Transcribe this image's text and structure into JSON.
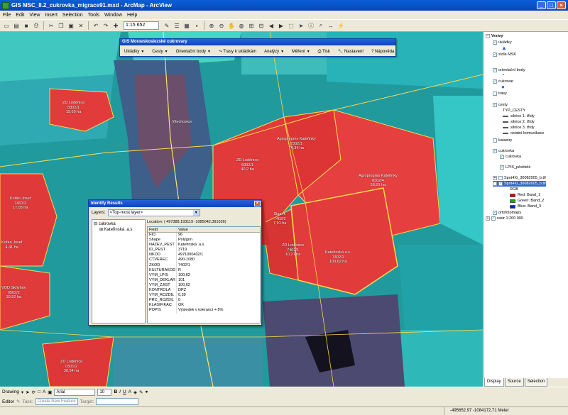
{
  "window": {
    "title": "GIS MSC_8.2_cukrovka_migrace91.mxd - ArcMap - ArcView"
  },
  "menu": [
    "File",
    "Edit",
    "View",
    "Insert",
    "Selection",
    "Tools",
    "Window",
    "Help"
  ],
  "toolbar": {
    "scale": "1:15 652"
  },
  "gis_toolbar": {
    "title": "GIS Moravskoslezské cukrovary",
    "buttons": [
      "Ukládky",
      "Cesty",
      "Orientační body",
      "Trasy k ukládkám",
      "Analýzy",
      "Měření",
      "Tisk",
      "Nastavení",
      "Nápověda"
    ]
  },
  "map": {
    "labels": [
      {
        "text": "ZD Loděnice\n8302/1\n19,69 ha"
      },
      {
        "text": "Všechovice"
      },
      {
        "text": "ZD Loděnice\n8302/1\n40,2 ha"
      },
      {
        "text": "Agroprogres Kateřinky\n7302/1\n74,34 ha"
      },
      {
        "text": "Agroprogres Kateřinky\n8302/4\n58,29 ha"
      },
      {
        "text": "Kateřinská a.s.\n7402/1\n100,62 ha"
      },
      {
        "text": "ZD Loděnice\n7402/1\n10,21 ha"
      },
      {
        "text": "Sigar f.\n7402/2\n7,91 ha"
      },
      {
        "text": "Kořán Josef\n7401/2\n17,05 ha"
      },
      {
        "text": "VOD Skřivňov\n0502/2\n30,52 ha"
      },
      {
        "text": "ZD Loděnice\n0501/2\n30,94 ha"
      },
      {
        "text": "Kořán Josef\n4,41 ha"
      }
    ]
  },
  "identify": {
    "title": "Identify Results",
    "layers_label": "Layers:",
    "layers_value": "<Top-most layer>",
    "tree": [
      "cukrovka",
      "Kateřinská .a.s"
    ],
    "location": "Location: ( 497388,193119 -1085042,391026)",
    "headers": [
      "Field",
      "Value"
    ],
    "rows": [
      [
        "FID",
        "96"
      ],
      [
        "Shape",
        "Polygon"
      ],
      [
        "NAZEV_PEST",
        "Kateřinská .a.s"
      ],
      [
        "ID_PEST",
        "3719"
      ],
      [
        "NKOD",
        "4971000402/1"
      ],
      [
        "CTVEREC",
        "490-1080"
      ],
      [
        "ZKOD",
        "7402/1"
      ],
      [
        "KULTURAKOD",
        "R"
      ],
      [
        "VYM_LPIS",
        "100,62"
      ],
      [
        "VYM_DEKLAR",
        "101"
      ],
      [
        "VYM_ZJIST",
        "100,62"
      ],
      [
        "KONTROLA",
        "DPZ"
      ],
      [
        "VYM_ROZDIL",
        "0,39"
      ],
      [
        "PRC_ROZDIL",
        "0"
      ],
      [
        "KLASIFIKAC",
        "OK"
      ],
      [
        "POPIS",
        "Výsledek v toleranci +-5%"
      ]
    ]
  },
  "toc": {
    "items": [
      {
        "label": "Vrstvy",
        "bold": true
      },
      {
        "label": "ukládky"
      },
      {
        "label": "sídla MSK"
      },
      {
        "label": "orientační body"
      },
      {
        "label": "cukrovar"
      },
      {
        "label": "trasy"
      },
      {
        "label": "cesty"
      },
      {
        "label": "TYP_CESTY"
      },
      {
        "label": "silnice 1. třídy"
      },
      {
        "label": "silnice 2. třídy"
      },
      {
        "label": "silnice 3. třídy"
      },
      {
        "label": "ostatní komunikace"
      },
      {
        "label": "katastry"
      },
      {
        "label": "cukrovka"
      },
      {
        "label": "cukrovka"
      },
      {
        "label": "LPIS_pěstitelé"
      },
      {
        "label": "Spot4Xi_30082005_b.tif"
      },
      {
        "label": "Spot4Xi_30082005_b.tif"
      },
      {
        "label": "RGB"
      },
      {
        "label": "Red:   Band_1"
      },
      {
        "label": "Green: Band_2"
      },
      {
        "label": "Blue:   Band_3"
      },
      {
        "label": "ortofotomapy"
      },
      {
        "label": "rastr 1:200 000"
      }
    ],
    "tabs": [
      "Display",
      "Source",
      "Selection"
    ]
  },
  "drawbar": {
    "drawing": "Drawing",
    "font": "Arial",
    "size": "10",
    "bold": "B",
    "italic": "I",
    "underline": "U"
  },
  "editbar": {
    "editor": "Editor",
    "task_label": "Task:",
    "task": "Create New Feature",
    "target_label": "Target:"
  },
  "status": {
    "coords": "-495652,97  -1084172,71 Meter"
  },
  "colors": {
    "title_bar": "#0a50c8",
    "field_red": "#e23b3b",
    "map_cyan": "#27b6b6"
  }
}
